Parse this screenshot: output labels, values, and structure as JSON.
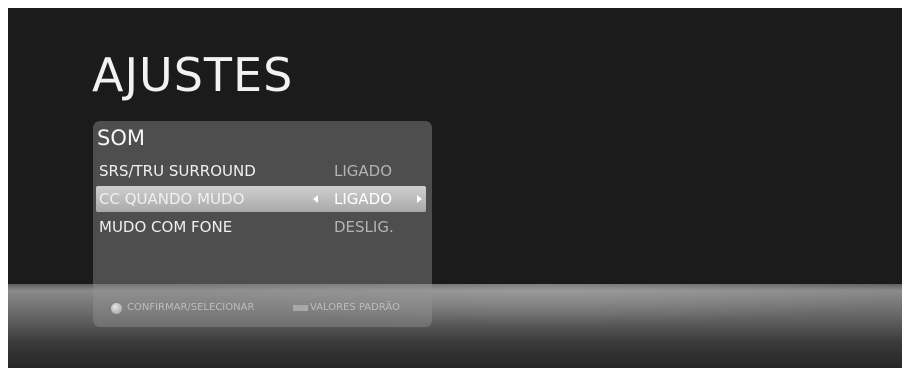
{
  "screen": {
    "title": "AJUSTES"
  },
  "panel": {
    "title": "SOM",
    "items": [
      {
        "label": "SRS/TRU SURROUND",
        "value": "LIGADO",
        "selected": false
      },
      {
        "label": "CC QUANDO MUDO",
        "value": "LIGADO",
        "selected": true
      },
      {
        "label": "MUDO COM FONE",
        "value": "DESLIG.",
        "selected": false
      }
    ],
    "footer": {
      "confirm_icon": "circle-button-icon",
      "confirm_label": "CONFIRMAR/SELECIONAR",
      "defaults_icon": "rect-button-icon",
      "defaults_label": "VALORES PADRÃO"
    }
  },
  "colors": {
    "background": "#1b1b1b",
    "panel": "#8a8a8a",
    "highlight": "#bdbdbd",
    "text": "#f0f0f0",
    "value_text": "#b4b4b4"
  }
}
